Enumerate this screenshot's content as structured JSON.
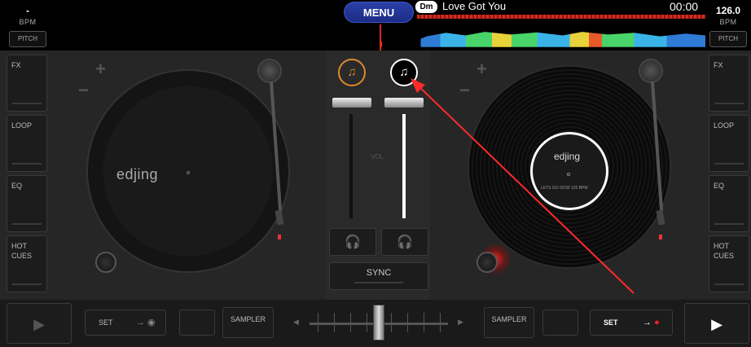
{
  "top_bar": {
    "left_bpm": "-",
    "left_bpm_label": "BPM",
    "left_pitch": "PITCH",
    "menu": "MENU",
    "key": "Dm",
    "track_title": "Love Got You",
    "time": "00:00",
    "right_bpm": "126.0",
    "right_bpm_label": "BPM",
    "right_pitch": "PITCH"
  },
  "left_sidebar": [
    "FX",
    "LOOP",
    "EQ",
    "HOT\nCUES"
  ],
  "right_sidebar": [
    "FX",
    "LOOP",
    "EQ",
    "HOT\nCUES"
  ],
  "left_deck": {
    "logo": "edjing"
  },
  "right_deck": {
    "logo": "edjing",
    "info": "LETS GO  00:00  126 BPM"
  },
  "mixer": {
    "vol_label": "VOL",
    "sync": "SYNC",
    "left_fader": 1.0,
    "right_fader": 1.0
  },
  "bottom": {
    "left_set": "SET",
    "left_sampler": "SAMPLER",
    "right_sampler": "SAMPLER",
    "right_set": "SET",
    "left_play_active": false,
    "right_play_active": true
  },
  "colors": {
    "accent_orange": "#e08a2c",
    "menu_blue": "#2b3fa8",
    "record_red": "#e22222",
    "annotation_red": "#ff2a2a"
  }
}
